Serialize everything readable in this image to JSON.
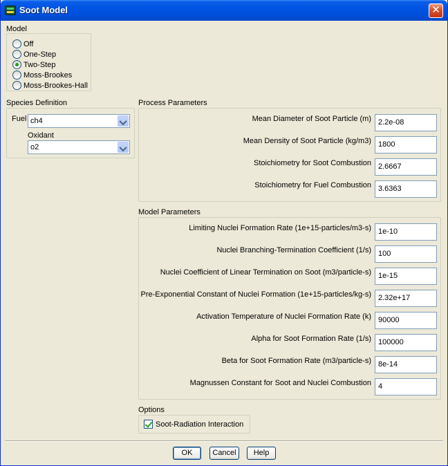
{
  "window": {
    "title": "Soot Model",
    "close_glyph": "✕"
  },
  "model": {
    "label": "Model",
    "options": [
      "Off",
      "One-Step",
      "Two-Step",
      "Moss-Brookes",
      "Moss-Brookes-Hall"
    ],
    "selected": "Two-Step"
  },
  "species": {
    "label": "Species Definition",
    "fuel_label": "Fuel",
    "fuel_value": "ch4",
    "oxidant_label": "Oxidant",
    "oxidant_value": "o2"
  },
  "process": {
    "label": "Process Parameters",
    "params": [
      {
        "label": "Mean Diameter of Soot Particle (m)",
        "value": "2.2e-08"
      },
      {
        "label": "Mean Density of Soot Particle (kg/m3)",
        "value": "1800"
      },
      {
        "label": "Stoichiometry for Soot Combustion",
        "value": "2.6667"
      },
      {
        "label": "Stoichiometry for Fuel Combustion",
        "value": "3.6363"
      }
    ]
  },
  "model_params": {
    "label": "Model Parameters",
    "params": [
      {
        "label": "Limiting Nuclei Formation Rate (1e+15-particles/m3-s)",
        "value": "1e-10"
      },
      {
        "label": "Nuclei Branching-Termination Coefficient (1/s)",
        "value": "100"
      },
      {
        "label": "Nuclei Coefficient of Linear Termination on Soot (m3/particle-s)",
        "value": "1e-15"
      },
      {
        "label": "Pre-Exponential Constant of Nuclei Formation (1e+15-particles/kg-s)",
        "value": "2.32e+17"
      },
      {
        "label": "Activation Temperature of Nuclei Formation Rate (k)",
        "value": "90000"
      },
      {
        "label": "Alpha for Soot Formation Rate (1/s)",
        "value": "100000"
      },
      {
        "label": "Beta for Soot Formation Rate (m3/particle-s)",
        "value": "8e-14"
      },
      {
        "label": "Magnussen Constant for Soot and Nuclei Combustion",
        "value": "4"
      }
    ]
  },
  "options": {
    "label": "Options",
    "soot_radiation_label": "Soot-Radiation Interaction",
    "soot_radiation_checked": true
  },
  "buttons": {
    "ok": "OK",
    "cancel": "Cancel",
    "help": "Help"
  }
}
